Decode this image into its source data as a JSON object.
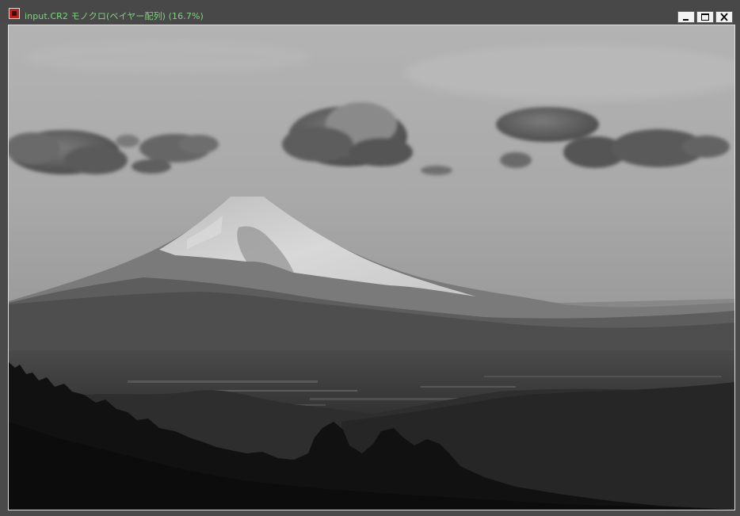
{
  "window": {
    "title": "input.CR2 モノクロ(ベイヤー配列) (16.7%)",
    "title_color": "#7ed47e",
    "app_icon": "photo-editor-app-icon",
    "buttons": {
      "minimize": "minimize-icon",
      "maximize": "maximize-icon",
      "close": "close-icon"
    }
  },
  "image": {
    "subject": "monochrome photograph of a snow-capped volcano above a valley town under a cloudy sky",
    "mode": "grayscale"
  }
}
